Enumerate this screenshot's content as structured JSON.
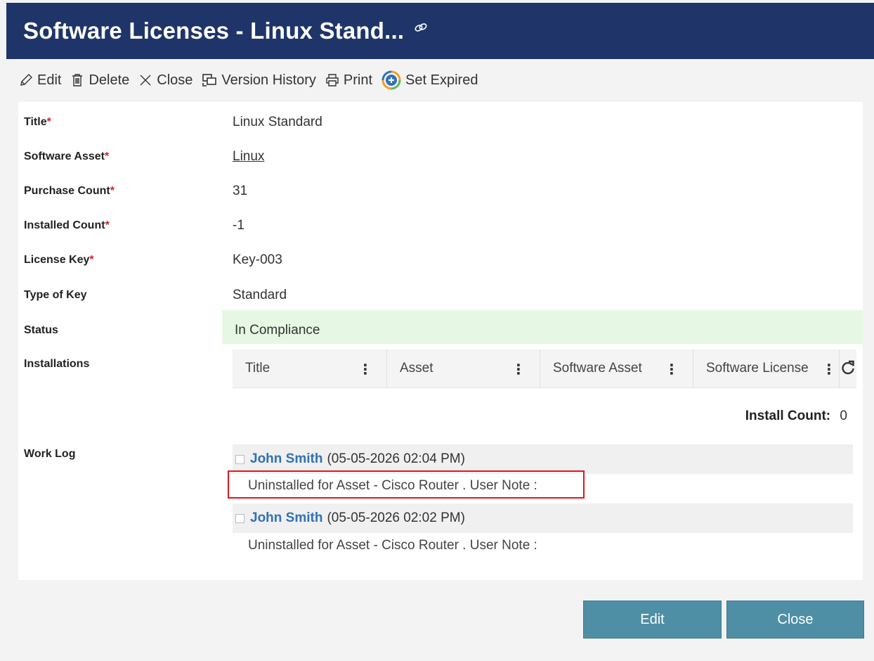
{
  "header": {
    "title": "Software Licenses - Linux Stand..."
  },
  "toolbar": {
    "edit": "Edit",
    "delete": "Delete",
    "close": "Close",
    "version_history": "Version History",
    "print": "Print",
    "set_expired": "Set Expired"
  },
  "fields": {
    "title": {
      "label": "Title",
      "value": "Linux Standard"
    },
    "software_asset": {
      "label": "Software Asset",
      "value": "Linux"
    },
    "purchase_count": {
      "label": "Purchase Count",
      "value": "31"
    },
    "installed_count": {
      "label": "Installed Count",
      "value": "-1"
    },
    "license_key": {
      "label": "License Key",
      "value": "Key-003"
    },
    "type_of_key": {
      "label": "Type of Key",
      "value": "Standard"
    },
    "status": {
      "label": "Status",
      "value": "In Compliance"
    },
    "installations": {
      "label": "Installations"
    },
    "work_log": {
      "label": "Work Log"
    }
  },
  "required_mark": "*",
  "installations_table": {
    "columns": [
      "Title",
      "Asset",
      "Software Asset",
      "Software License"
    ],
    "install_count_label": "Install Count:",
    "install_count_value": "0"
  },
  "work_log": [
    {
      "author": "John Smith",
      "timestamp": "(05-05-2026 02:04 PM)",
      "note": "Uninstalled for Asset - Cisco Router . User Note :"
    },
    {
      "author": "John Smith",
      "timestamp": "(05-05-2026 02:02 PM)",
      "note": "Uninstalled for Asset - Cisco Router . User Note :"
    }
  ],
  "buttons": {
    "edit": "Edit",
    "close": "Close"
  },
  "colors": {
    "header_bg": "#1f3569",
    "status_bg": "#e6f8e3",
    "button_bg": "#4f8fa5",
    "author_link": "#2f72b6",
    "required": "#d2232a",
    "highlight_border": "#e0181c"
  },
  "icons": [
    "link-icon",
    "pencil-icon",
    "trash-icon",
    "close-x-icon",
    "version-history-icon",
    "printer-icon",
    "set-expired-icon",
    "more-vertical-icon",
    "refresh-icon"
  ]
}
